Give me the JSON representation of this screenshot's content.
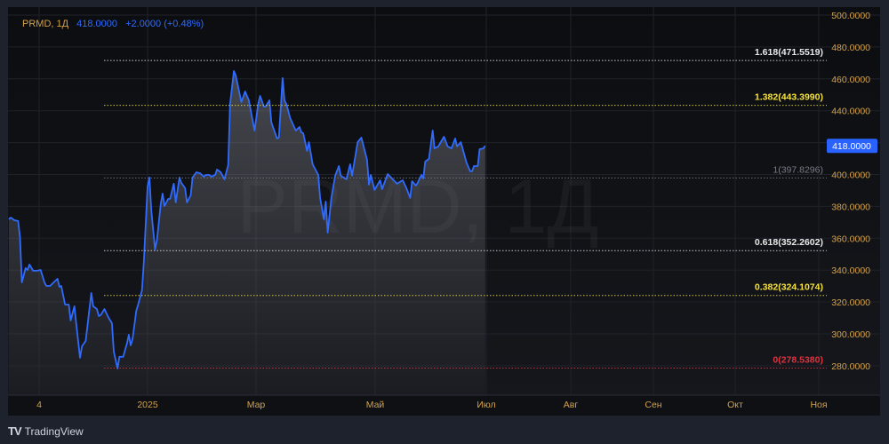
{
  "legend": {
    "symbol": "PRMD, 1Д",
    "price": "418.0000",
    "change": "+2.0000 (+0.48%)"
  },
  "watermark": "PRMD, 1Д",
  "branding": {
    "name": "TradingView"
  },
  "colors": {
    "line": "#2f6bff",
    "axis_text": "#d4a24a",
    "badge": "#2962ff",
    "grid": "#1f222a"
  },
  "chart_data": {
    "type": "area",
    "title": "PRMD, 1Д",
    "xlabel": "",
    "ylabel": "",
    "x_unit": "days since 2025-01-01",
    "ylim": [
      270,
      505
    ],
    "y_ticks": [
      500,
      480,
      460,
      440,
      420,
      400,
      380,
      360,
      340,
      320,
      300,
      280
    ],
    "y_tick_labels": [
      "500.0000",
      "480.0000",
      "460.0000",
      "440.0000",
      "420.0000",
      "400.0000",
      "380.0000",
      "360.0000",
      "340.0000",
      "320.0000",
      "300.0000",
      "280.0000"
    ],
    "x_tick_labels": [
      "4",
      "2025",
      "Мар",
      "Май",
      "Июл",
      "Авг",
      "Сен",
      "Окт",
      "Ноя"
    ],
    "grid": true,
    "last_price": {
      "value": 418.0,
      "label": "418.0000"
    },
    "fib_levels": [
      {
        "label": "1.618(471.5519)",
        "value": 471.5519,
        "color": "#e8e8e8"
      },
      {
        "label": "1.382(443.3990)",
        "value": 443.399,
        "color": "#f5e23a"
      },
      {
        "label": "1(397.8296)",
        "value": 397.8296,
        "color": "#787b86"
      },
      {
        "label": "0.618(352.2602)",
        "value": 352.2602,
        "color": "#e8e8e8"
      },
      {
        "label": "0.382(324.1074)",
        "value": 324.1074,
        "color": "#f5e23a"
      },
      {
        "label": "0(278.5380)",
        "value": 278.538,
        "color": "#e0323f"
      }
    ],
    "series": [
      {
        "name": "PRMD",
        "points": [
          [
            -74,
            371.9
          ],
          [
            -73,
            373.0
          ],
          [
            -71,
            371.3
          ],
          [
            -69,
            370.8
          ],
          [
            -68,
            360.7
          ],
          [
            -67,
            332.3
          ],
          [
            -65,
            341.3
          ],
          [
            -64,
            340.1
          ],
          [
            -63,
            343.5
          ],
          [
            -61,
            339.6
          ],
          [
            -59,
            339.6
          ],
          [
            -57,
            340.1
          ],
          [
            -55,
            332.3
          ],
          [
            -54,
            330.1
          ],
          [
            -52,
            330.1
          ],
          [
            -49,
            333.5
          ],
          [
            -48,
            334.6
          ],
          [
            -47,
            329.6
          ],
          [
            -46,
            330.1
          ],
          [
            -44,
            318.4
          ],
          [
            -42,
            318.4
          ],
          [
            -41,
            308.4
          ],
          [
            -39,
            317.3
          ],
          [
            -38,
            306.2
          ],
          [
            -36,
            285.0
          ],
          [
            -35,
            292.2
          ],
          [
            -33,
            295.6
          ],
          [
            -30,
            325.7
          ],
          [
            -29,
            317.3
          ],
          [
            -27,
            315.6
          ],
          [
            -26,
            311.2
          ],
          [
            -25,
            311.8
          ],
          [
            -23,
            315.6
          ],
          [
            -21,
            310.6
          ],
          [
            -19,
            306.7
          ],
          [
            -18,
            288.9
          ],
          [
            -16,
            278.3
          ],
          [
            -15,
            285.6
          ],
          [
            -13,
            285.6
          ],
          [
            -11,
            293.9
          ],
          [
            -10,
            299.5
          ],
          [
            -9,
            292.8
          ],
          [
            -8,
            296.7
          ],
          [
            -6,
            314.5
          ],
          [
            -5,
            318.4
          ],
          [
            -3,
            327.3
          ],
          [
            -2,
            345.2
          ],
          [
            0,
            392.5
          ],
          [
            1,
            398.1
          ],
          [
            2,
            377.5
          ],
          [
            4,
            353.0
          ],
          [
            5,
            359.1
          ],
          [
            7,
            381.4
          ],
          [
            8,
            388.0
          ],
          [
            9,
            380.2
          ],
          [
            11,
            384.7
          ],
          [
            12,
            384.7
          ],
          [
            14,
            394.2
          ],
          [
            15,
            382.5
          ],
          [
            17,
            398.1
          ],
          [
            18,
            394.7
          ],
          [
            20,
            391.4
          ],
          [
            21,
            382.5
          ],
          [
            23,
            386.9
          ],
          [
            24,
            398.1
          ],
          [
            26,
            401.4
          ],
          [
            28,
            400.8
          ],
          [
            30,
            398.6
          ],
          [
            31,
            399.7
          ],
          [
            33,
            399.7
          ],
          [
            34,
            398.6
          ],
          [
            36,
            399.7
          ],
          [
            37,
            403.1
          ],
          [
            39,
            401.4
          ],
          [
            41,
            397.0
          ],
          [
            43,
            405.9
          ],
          [
            44,
            444.3
          ],
          [
            46,
            464.9
          ],
          [
            47,
            462.1
          ],
          [
            48,
            456.6
          ],
          [
            50,
            445.4
          ],
          [
            52,
            452.1
          ],
          [
            54,
            446.5
          ],
          [
            57,
            427.6
          ],
          [
            59,
            444.3
          ],
          [
            60,
            449.3
          ],
          [
            62,
            442.6
          ],
          [
            63,
            442.6
          ],
          [
            65,
            446.5
          ],
          [
            66,
            432.6
          ],
          [
            69,
            422.6
          ],
          [
            70,
            423.1
          ],
          [
            72,
            460.5
          ],
          [
            73,
            446.5
          ],
          [
            74,
            444.3
          ],
          [
            76,
            435.4
          ],
          [
            79,
            427.6
          ],
          [
            81,
            429.8
          ],
          [
            82,
            426.5
          ],
          [
            83,
            425.9
          ],
          [
            85,
            414.8
          ],
          [
            86,
            420.3
          ],
          [
            88,
            406.4
          ],
          [
            91,
            399.7
          ],
          [
            92,
            385.3
          ],
          [
            94,
            371.9
          ],
          [
            95,
            383.0
          ],
          [
            96,
            363.5
          ],
          [
            98,
            385.3
          ],
          [
            100,
            399.2
          ],
          [
            102,
            405.3
          ],
          [
            103,
            399.2
          ],
          [
            106,
            397.0
          ],
          [
            108,
            406.4
          ],
          [
            109,
            399.2
          ],
          [
            112,
            420.3
          ],
          [
            114,
            423.1
          ],
          [
            117,
            409.2
          ],
          [
            118,
            393.6
          ],
          [
            119,
            399.7
          ],
          [
            121,
            390.3
          ],
          [
            124,
            396.4
          ],
          [
            125,
            390.8
          ],
          [
            128,
            400.3
          ],
          [
            133,
            394.2
          ],
          [
            136,
            396.4
          ],
          [
            138,
            391.4
          ],
          [
            140,
            385.3
          ],
          [
            141,
            395.8
          ],
          [
            143,
            393.0
          ],
          [
            144,
            394.7
          ],
          [
            146,
            399.7
          ],
          [
            147,
            397.5
          ],
          [
            148,
            408.1
          ],
          [
            150,
            409.8
          ],
          [
            152,
            427.6
          ],
          [
            153,
            416.4
          ],
          [
            155,
            417.6
          ],
          [
            158,
            423.7
          ],
          [
            160,
            417.6
          ],
          [
            162,
            416.4
          ],
          [
            164,
            422.6
          ],
          [
            165,
            417.6
          ],
          [
            167,
            420.3
          ],
          [
            170,
            407.5
          ],
          [
            172,
            402.0
          ],
          [
            173,
            402.0
          ],
          [
            174,
            405.3
          ],
          [
            176,
            405.3
          ],
          [
            177,
            415.9
          ],
          [
            179,
            416.4
          ],
          [
            180,
            418.0
          ]
        ]
      }
    ]
  }
}
